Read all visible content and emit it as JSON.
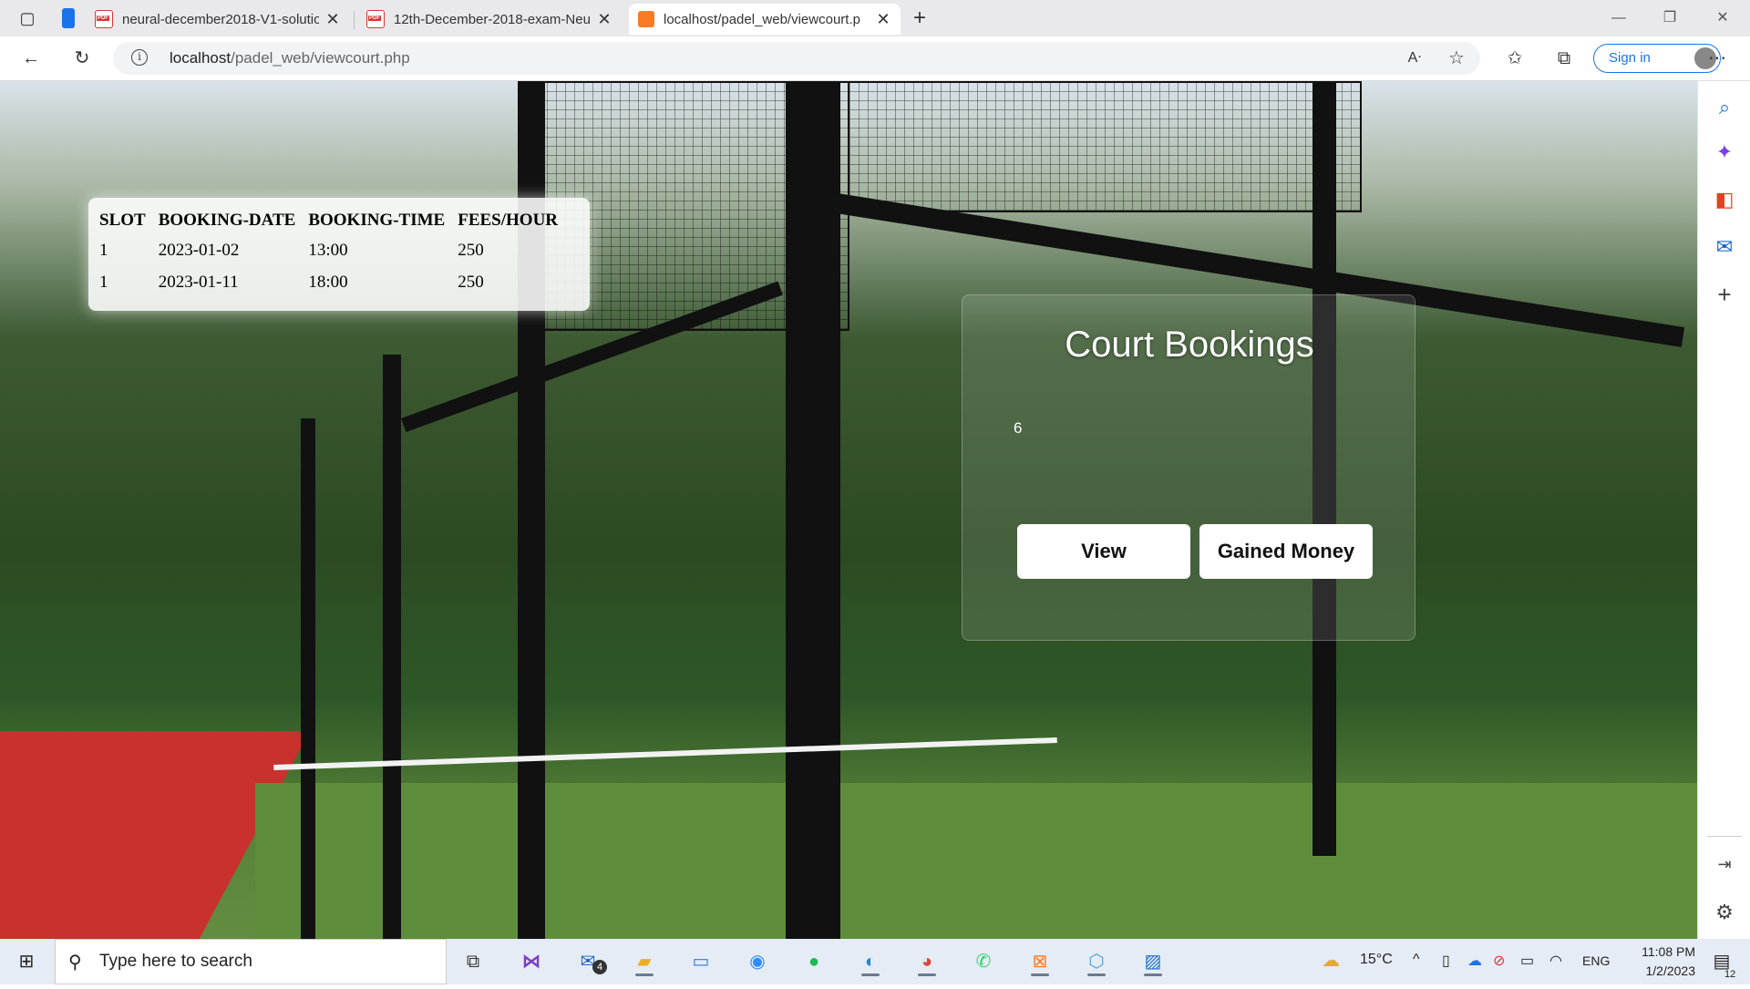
{
  "browser": {
    "tabs": [
      {
        "title": "neural-december2018-V1-solutio",
        "icon": "pdf-icon",
        "active": false
      },
      {
        "title": "12th-December-2018-exam-Neu",
        "icon": "pdf-icon",
        "active": false
      },
      {
        "title": "localhost/padel_web/viewcourt.p",
        "icon": "xampp-icon",
        "active": true
      }
    ],
    "url_host": "localhost",
    "url_path": "/padel_web/viewcourt.php",
    "signin_label": "Sign in"
  },
  "bookings_table": {
    "headers": [
      "SLOT",
      "BOOKING-DATE",
      "BOOKING-TIME",
      "FEES/HOUR"
    ],
    "rows": [
      [
        "1",
        "2023-01-02",
        "13:00",
        "250"
      ],
      [
        "1",
        "2023-01-11",
        "18:00",
        "250"
      ]
    ]
  },
  "panel": {
    "title": "Court Bookings",
    "field_value": "6",
    "view_label": "View",
    "gained_label": "Gained Money"
  },
  "taskbar": {
    "search_placeholder": "Type here to search",
    "mail_badge": "4",
    "weather": "15°C",
    "language": "ENG",
    "time": "11:08 PM",
    "date": "1/2/2023",
    "notifications": "12"
  },
  "colors": {
    "accent": "#1a73e8",
    "court_red": "#c8312d",
    "grass": "#5e8e3b"
  }
}
